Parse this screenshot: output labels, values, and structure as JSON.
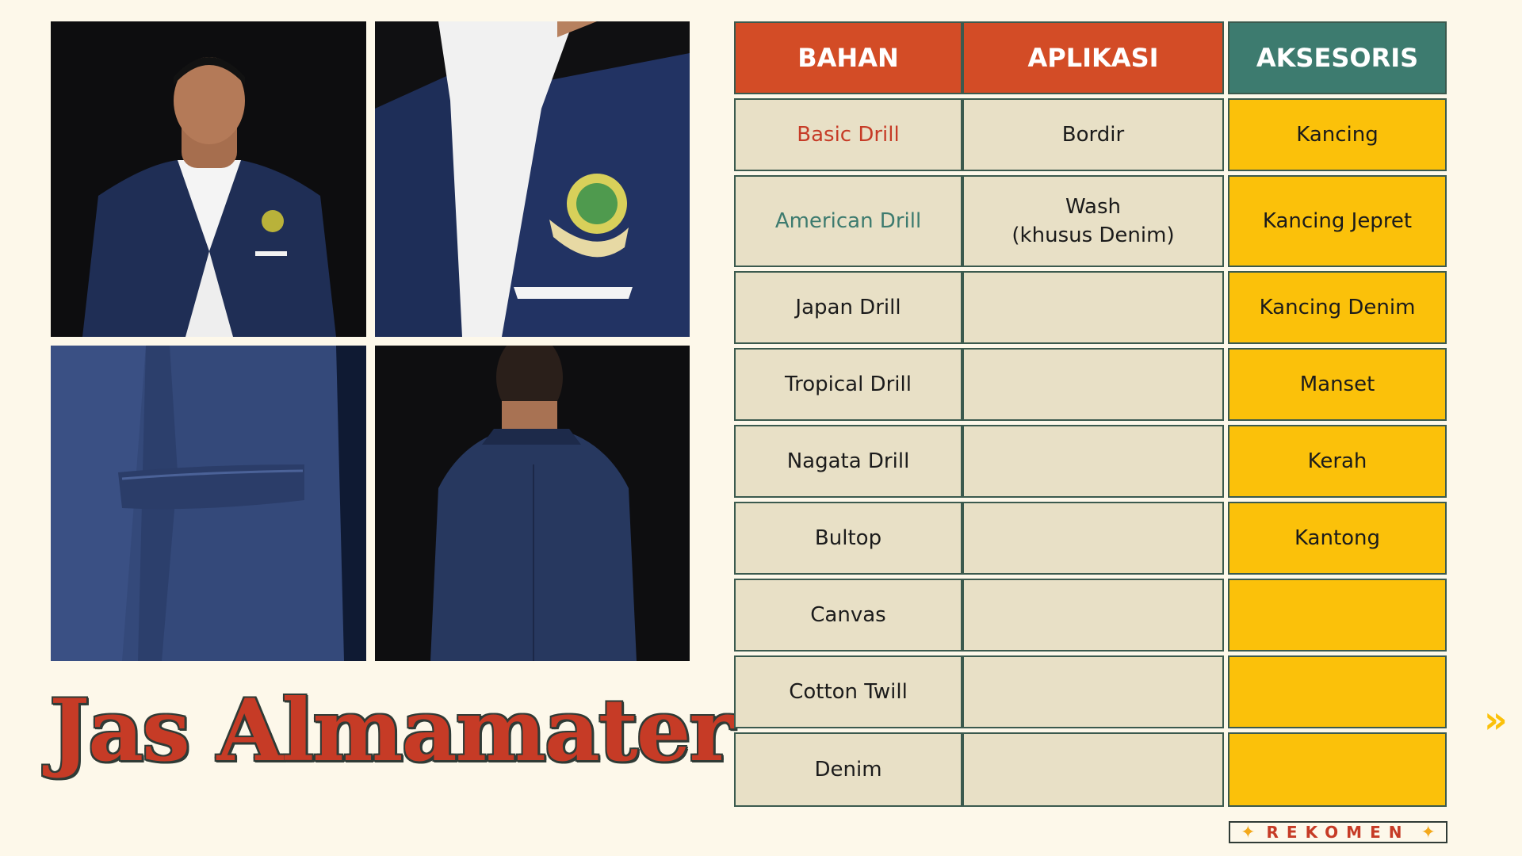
{
  "title": "Jas Almamater",
  "table": {
    "headers": [
      "BAHAN",
      "APLIKASI",
      "AKSESORIS"
    ],
    "header_colors": [
      "#d34c26",
      "#d34c26",
      "#3d7b6f"
    ],
    "rows": [
      {
        "bahan": "Basic Drill",
        "aplikasi": "Bordir",
        "aksesoris": "Kancing"
      },
      {
        "bahan": "American Drill",
        "aplikasi": "Wash\n(khusus Denim)",
        "aksesoris": "Kancing Jepret"
      },
      {
        "bahan": "Japan Drill",
        "aplikasi": "",
        "aksesoris": "Kancing Denim"
      },
      {
        "bahan": "Tropical Drill",
        "aplikasi": "",
        "aksesoris": "Manset"
      },
      {
        "bahan": "Nagata Drill",
        "aplikasi": "",
        "aksesoris": "Kerah"
      },
      {
        "bahan": "Bultop",
        "aplikasi": "",
        "aksesoris": "Kantong"
      },
      {
        "bahan": "Canvas",
        "aplikasi": "",
        "aksesoris": ""
      },
      {
        "bahan": "Cotton Twill",
        "aplikasi": "",
        "aksesoris": ""
      },
      {
        "bahan": "Denim",
        "aplikasi": "",
        "aksesoris": ""
      }
    ]
  },
  "badge": {
    "label": "REKOMEN",
    "star": "✦"
  },
  "next_icon": "»",
  "icons": {
    "next": "double-chevron-right-icon",
    "star": "star-icon"
  },
  "colors": {
    "background": "#fdf8ea",
    "red": "#c63b26",
    "teal": "#3d7b6f",
    "beige": "#e8e0c6",
    "yellow": "#fbc10a"
  }
}
